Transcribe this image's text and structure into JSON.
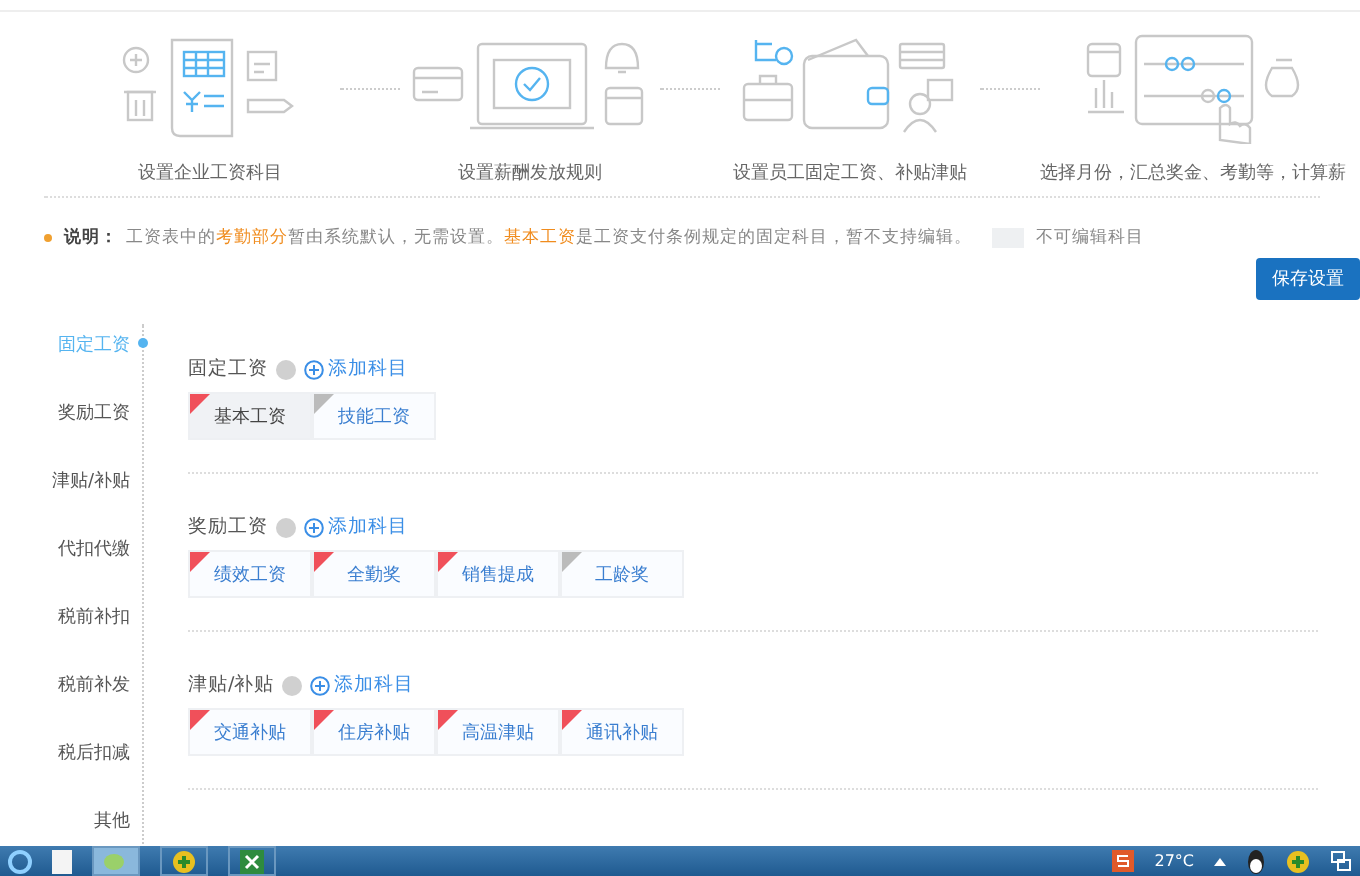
{
  "steps": [
    {
      "label": "设置企业工资科目",
      "kind": "items"
    },
    {
      "label": "设置薪酬发放规则",
      "kind": "rules"
    },
    {
      "label": "设置员工固定工资、补贴津贴",
      "kind": "wallet"
    },
    {
      "label": "选择月份，汇总奖金、考勤等，计算薪",
      "kind": "calc"
    }
  ],
  "note": {
    "label": "说明：",
    "segments": [
      {
        "text": "工资表中的",
        "highlight": false
      },
      {
        "text": "考勤部分",
        "highlight": true
      },
      {
        "text": "暂由系统默认，无需设置。",
        "highlight": false
      },
      {
        "text": "基本工资",
        "highlight": true
      },
      {
        "text": "是工资支付条例规定的固定科目，暂不支持编辑。",
        "highlight": false
      }
    ],
    "legend": "不可编辑科目"
  },
  "save_button": "保存设置",
  "sidebar": {
    "items": [
      {
        "label": "固定工资",
        "selected": true
      },
      {
        "label": "奖励工资",
        "selected": false
      },
      {
        "label": "津贴/补贴",
        "selected": false
      },
      {
        "label": "代扣代缴",
        "selected": false
      },
      {
        "label": "税前补扣",
        "selected": false
      },
      {
        "label": "税前补发",
        "selected": false
      },
      {
        "label": "税后扣减",
        "selected": false
      },
      {
        "label": "其他",
        "selected": false
      }
    ]
  },
  "sections": [
    {
      "title": "固定工资",
      "add": "添加科目",
      "items": [
        {
          "label": "基本工资",
          "editable": false,
          "color": "#f0505a"
        },
        {
          "label": "技能工资",
          "editable": true,
          "color": "#bbbbbb"
        }
      ]
    },
    {
      "title": "奖励工资",
      "add": "添加科目",
      "items": [
        {
          "label": "绩效工资",
          "editable": true,
          "color": "#f0505a"
        },
        {
          "label": "全勤奖",
          "editable": true,
          "color": "#f0505a"
        },
        {
          "label": "销售提成",
          "editable": true,
          "color": "#f0505a"
        },
        {
          "label": "工龄奖",
          "editable": true,
          "color": "#bbbbbb"
        }
      ]
    },
    {
      "title": "津贴/补贴",
      "add": "添加科目",
      "items": [
        {
          "label": "交通补贴",
          "editable": true,
          "color": "#f0505a"
        },
        {
          "label": "住房补贴",
          "editable": true,
          "color": "#f0505a"
        },
        {
          "label": "高温津贴",
          "editable": true,
          "color": "#f0505a"
        },
        {
          "label": "通讯补贴",
          "editable": true,
          "color": "#f0505a"
        }
      ]
    }
  ],
  "taskbar": {
    "temperature": "27°C"
  }
}
